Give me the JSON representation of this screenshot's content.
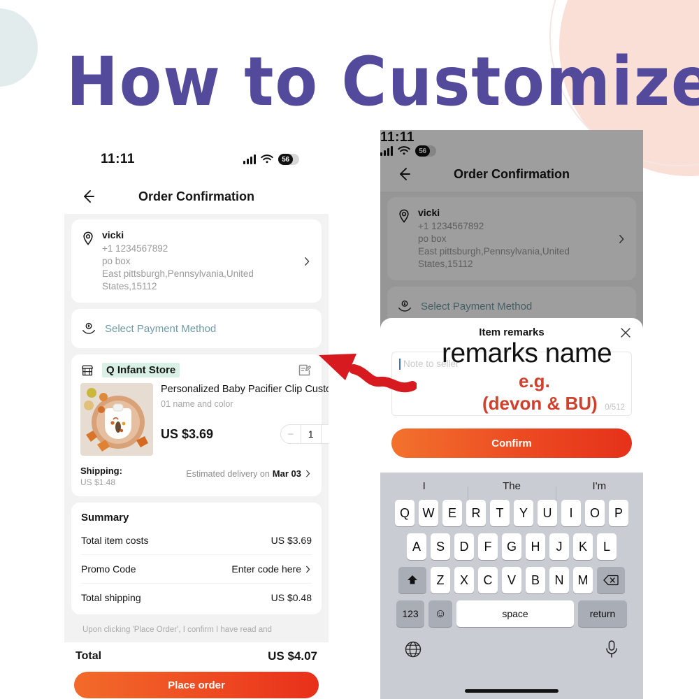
{
  "banner": {
    "title": "How to Customize",
    "title_color": "#534a9c"
  },
  "decor": {
    "mint_circle": "#e2ecec",
    "pink_circle": "#fadfd7"
  },
  "left_phone": {
    "status_bar": {
      "time": "11:11",
      "battery_level": "56",
      "signal_icon": "signal-bars-icon",
      "wifi_icon": "wifi-icon",
      "battery_icon": "battery-icon"
    },
    "nav": {
      "back_icon": "back-arrow-icon",
      "title": "Order Confirmation"
    },
    "address": {
      "pin_icon": "location-pin-icon",
      "name": "vicki",
      "phone": "+1 1234567892",
      "line1": "po box",
      "line2": "East pittsburgh,Pennsylvania,United",
      "line3": "States,15112",
      "chevron_icon": "chevron-right-icon"
    },
    "payment": {
      "icon": "payment-hand-coin-icon",
      "label": "Select Payment Method",
      "label_color": "#6f9aa6"
    },
    "store": {
      "shop_icon": "storefront-icon",
      "name": "Q Infant Store",
      "highlight_color": "#d8f0e6",
      "edit_icon": "edit-note-icon"
    },
    "product": {
      "title": "Personalized Baby Pacifier Clip Custo…",
      "variant": "01 name and color",
      "price": "US $3.69",
      "quantity": "1",
      "minus_icon": "minus-icon",
      "plus_icon": "plus-icon",
      "image_alt": "thanksgiving-baby-bib-photo"
    },
    "shipping": {
      "label": "Shipping:",
      "cost": "US $1.48",
      "delivery_prefix": "Estimated delivery on",
      "delivery_date": "Mar 03",
      "chevron_icon": "chevron-right-icon"
    },
    "summary": {
      "heading": "Summary",
      "rows": [
        {
          "label": "Total item costs",
          "value": "US $3.69",
          "linked": false
        },
        {
          "label": "Promo Code",
          "value": "Enter code here",
          "linked": true
        },
        {
          "label": "Total shipping",
          "value": "US $0.48",
          "linked": false
        }
      ]
    },
    "terms": "Upon clicking 'Place Order', I confirm I have read and",
    "total": {
      "label": "Total",
      "amount": "US $4.07"
    },
    "place_order_label": "Place order",
    "cta_gradient": [
      "#f26b2a",
      "#e8301a"
    ]
  },
  "right_phone": {
    "status_bar": {
      "time": "11:11",
      "battery_level": "56"
    },
    "nav": {
      "title": "Order Confirmation",
      "back_icon": "back-arrow-icon"
    },
    "address": {
      "name": "vicki",
      "phone": "+1 1234567892",
      "line1": "po box",
      "line2": "East pittsburgh,Pennsylvania,United",
      "line3": "States,15112"
    },
    "payment_label": "Select Payment Method",
    "modal": {
      "title": "Item remarks",
      "close_icon": "close-x-icon",
      "note_placeholder": "Note to seller",
      "char_counter": "0/512",
      "confirm_label": "Confirm"
    },
    "keyboard": {
      "suggestions": [
        "I",
        "The",
        "I'm"
      ],
      "row1": [
        "Q",
        "W",
        "E",
        "R",
        "T",
        "Y",
        "U",
        "I",
        "O",
        "P"
      ],
      "row2": [
        "A",
        "S",
        "D",
        "F",
        "G",
        "H",
        "J",
        "K",
        "L"
      ],
      "row3": [
        "Z",
        "X",
        "C",
        "V",
        "B",
        "N",
        "M"
      ],
      "shift_icon": "shift-arrow-icon",
      "backspace_icon": "backspace-icon",
      "numbers_label": "123",
      "emoji_icon": "emoji-smiley-icon",
      "space_label": "space",
      "return_label": "return",
      "globe_icon": "globe-icon",
      "mic_icon": "microphone-icon"
    }
  },
  "annotations": {
    "remarks_name": "remarks name",
    "eg": "e.g.",
    "example": "(devon & BU)",
    "arrow": "red-wavy-arrow",
    "accent_color": "#d0402c"
  }
}
